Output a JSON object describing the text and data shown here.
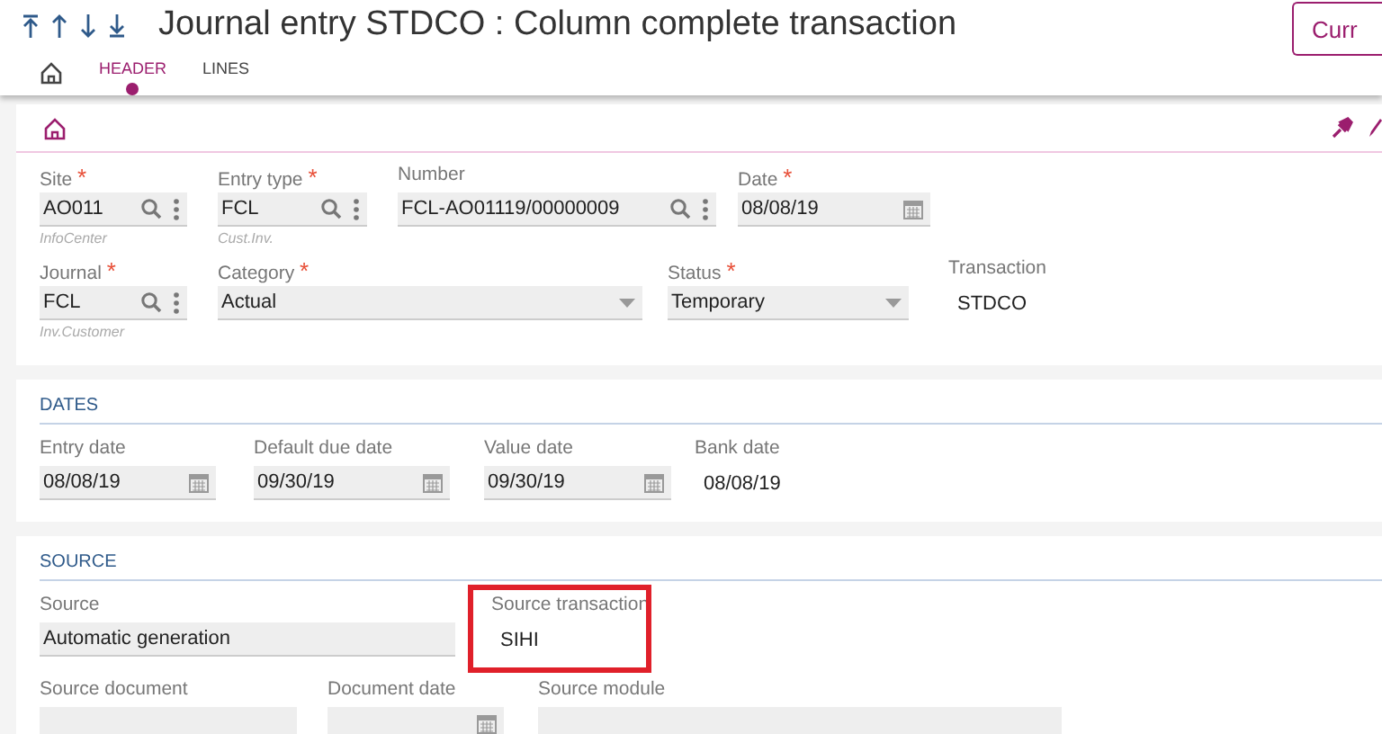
{
  "header": {
    "title": "Journal entry STDCO : Column complete transaction",
    "action_button": "Curr"
  },
  "tabs": [
    {
      "label": "HEADER",
      "selected": true
    },
    {
      "label": "LINES",
      "selected": false
    }
  ],
  "main_rows": [
    {
      "fields": [
        {
          "label": "Site",
          "required_mark": "*",
          "kind": "lookup",
          "value": "AO011",
          "hint": "InfoCenter"
        },
        {
          "label": "Entry type",
          "required_mark": "*",
          "kind": "lookup",
          "value": "FCL",
          "hint": "Cust.Inv."
        },
        {
          "label": "Number",
          "kind": "lookup",
          "value": "FCL-AO01119/00000009"
        },
        {
          "label": "Date",
          "required_mark": "*",
          "kind": "date",
          "value": "08/08/19"
        }
      ]
    },
    {
      "fields": [
        {
          "label": "Journal",
          "required_mark": "*",
          "kind": "lookup",
          "value": "FCL",
          "hint": "Inv.Customer"
        },
        {
          "label": "Category",
          "required_mark": "*",
          "kind": "select",
          "value": "Actual"
        },
        {
          "label": "Status",
          "required_mark": "*",
          "kind": "select",
          "value": "Temporary"
        },
        {
          "label": "Transaction",
          "kind": "text",
          "value": "STDCO"
        }
      ]
    }
  ],
  "sections": [
    {
      "title": "DATES",
      "lines": [
        {
          "fields": [
            {
              "label": "Entry date",
              "kind": "date",
              "value": "08/08/19"
            },
            {
              "label": "Default due date",
              "kind": "date",
              "value": "09/30/19"
            },
            {
              "label": "Value date",
              "kind": "date",
              "value": "09/30/19"
            },
            {
              "label": "Bank date",
              "kind": "text",
              "value": "08/08/19"
            }
          ]
        }
      ]
    },
    {
      "title": "SOURCE",
      "lines": [
        {
          "fields": [
            {
              "label": "Source",
              "kind": "input",
              "value": "Automatic generation"
            },
            {
              "label": "Source transaction",
              "kind": "text",
              "value": "SIHI",
              "highlighted": true
            }
          ]
        },
        {
          "fields": [
            {
              "label": "Source document",
              "kind": "input"
            },
            {
              "label": "Document date",
              "kind": "date"
            },
            {
              "label": "Source module",
              "kind": "input"
            }
          ]
        }
      ]
    }
  ]
}
